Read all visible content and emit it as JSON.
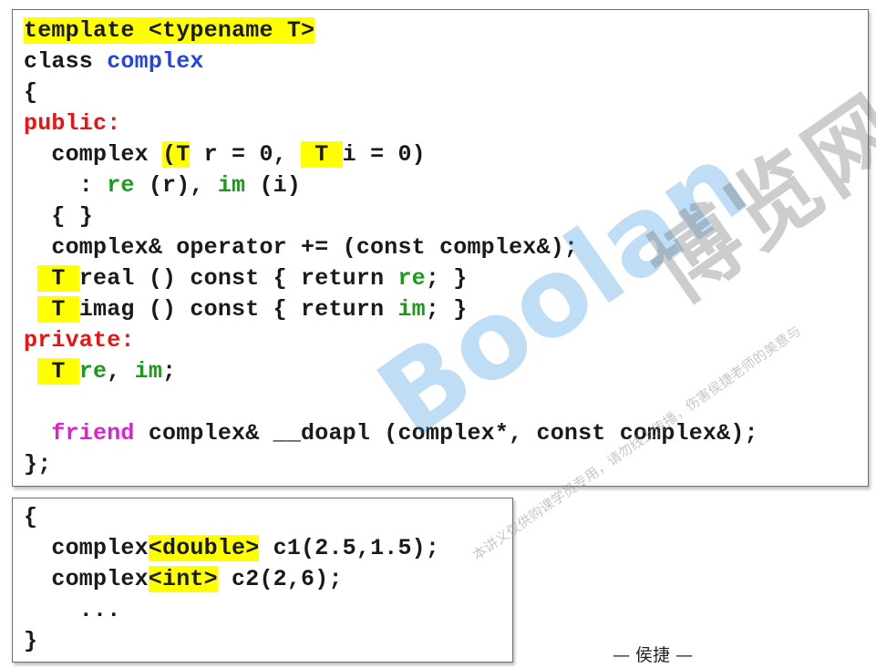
{
  "main_code": [
    [
      {
        "t": "template <typename T>",
        "c": "",
        "h": true
      }
    ],
    [
      {
        "t": "class ",
        "c": ""
      },
      {
        "t": "complex",
        "c": "kw-blue"
      }
    ],
    [
      {
        "t": "{",
        "c": ""
      }
    ],
    [
      {
        "t": "public:",
        "c": "kw-red"
      }
    ],
    [
      {
        "t": "  complex ",
        "c": ""
      },
      {
        "t": "(T",
        "c": "",
        "h": true
      },
      {
        "t": " r = 0, ",
        "c": ""
      },
      {
        "t": " T ",
        "c": "",
        "h": true
      },
      {
        "t": "i = 0)",
        "c": ""
      }
    ],
    [
      {
        "t": "    : ",
        "c": ""
      },
      {
        "t": "re",
        "c": "kw-green"
      },
      {
        "t": " (r), ",
        "c": ""
      },
      {
        "t": "im",
        "c": "kw-green"
      },
      {
        "t": " (i)",
        "c": ""
      }
    ],
    [
      {
        "t": "  { }",
        "c": ""
      }
    ],
    [
      {
        "t": "  complex& operator += (const complex&);",
        "c": ""
      }
    ],
    [
      {
        "t": " ",
        "c": ""
      },
      {
        "t": " T ",
        "c": "",
        "h": true
      },
      {
        "t": "real () const { return ",
        "c": ""
      },
      {
        "t": "re",
        "c": "kw-green"
      },
      {
        "t": "; }",
        "c": ""
      }
    ],
    [
      {
        "t": " ",
        "c": ""
      },
      {
        "t": " T ",
        "c": "",
        "h": true
      },
      {
        "t": "imag () const { return ",
        "c": ""
      },
      {
        "t": "im",
        "c": "kw-green"
      },
      {
        "t": "; }",
        "c": ""
      }
    ],
    [
      {
        "t": "private:",
        "c": "kw-red"
      }
    ],
    [
      {
        "t": " ",
        "c": ""
      },
      {
        "t": " T ",
        "c": "",
        "h": true
      },
      {
        "t": "re",
        "c": "kw-green"
      },
      {
        "t": ", ",
        "c": ""
      },
      {
        "t": "im",
        "c": "kw-green"
      },
      {
        "t": ";",
        "c": ""
      }
    ],
    [
      {
        "t": "",
        "c": ""
      }
    ],
    [
      {
        "t": "  ",
        "c": ""
      },
      {
        "t": "friend",
        "c": "kw-pink"
      },
      {
        "t": " complex& __doapl (complex*, const complex&);",
        "c": ""
      }
    ],
    [
      {
        "t": "};",
        "c": ""
      }
    ]
  ],
  "usage_code": [
    [
      {
        "t": "{",
        "c": ""
      }
    ],
    [
      {
        "t": "  complex",
        "c": ""
      },
      {
        "t": "<double>",
        "c": "",
        "h": true
      },
      {
        "t": " c1(2.5,1.5);",
        "c": ""
      }
    ],
    [
      {
        "t": "  complex",
        "c": ""
      },
      {
        "t": "<int>",
        "c": "",
        "h": true
      },
      {
        "t": " c2(2,6);",
        "c": ""
      }
    ],
    [
      {
        "t": "    ...",
        "c": ""
      }
    ],
    [
      {
        "t": "}",
        "c": ""
      }
    ]
  ],
  "author": "— 侯捷 —",
  "watermark": {
    "brand": "Boolan",
    "site": "博览网",
    "notice": "本讲义仅供购课学员专用，请勿线上传播，伤害侯捷老师的美意与"
  },
  "colors": {
    "highlight": "#ffff00",
    "keyword_blue": "#2244ee",
    "keyword_red": "#ee1111",
    "member_green": "#1b9a1b",
    "friend_pink": "#e020d0",
    "watermark_blue": "#1e88d8"
  }
}
